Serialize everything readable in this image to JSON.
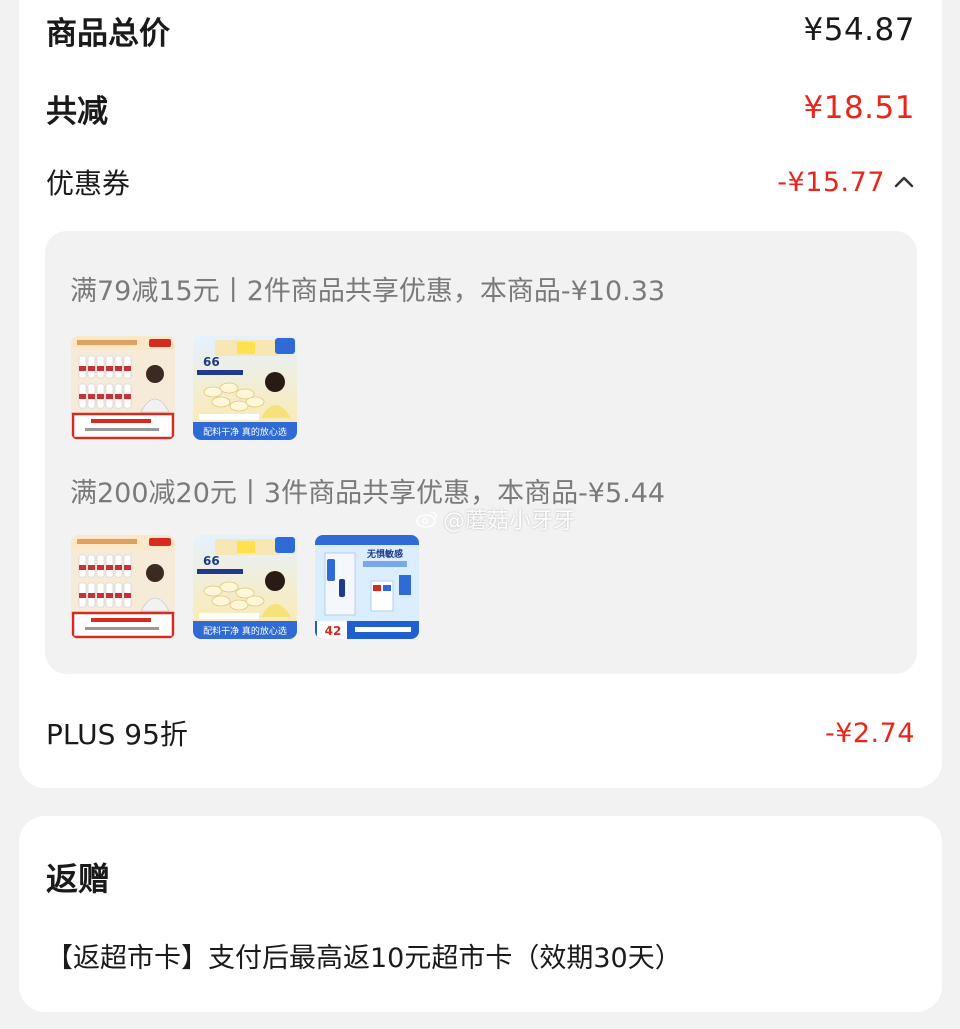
{
  "summary": {
    "total_label": "商品总价",
    "total_value": "¥54.87",
    "reduce_label": "共减",
    "reduce_value": "¥18.51",
    "coupon_label": "优惠券",
    "coupon_value": "-¥15.77",
    "plus_label": "PLUS 95折",
    "plus_value": "-¥2.74"
  },
  "coupon_details": [
    {
      "text": "满79减15元丨2件商品共享优惠，本商品-¥10.33",
      "thumbnails": [
        "milk-bottles-thumbnail",
        "milk-tablets-thumbnail"
      ]
    },
    {
      "text": "满200减20元丨3件商品共享优惠，本商品-¥5.44",
      "thumbnails": [
        "milk-bottles-thumbnail",
        "milk-tablets-thumbnail",
        "health-product-thumbnail"
      ]
    }
  ],
  "thumb_texts": {
    "milk_big": "66",
    "milk_bottom": "配料干净 真的放心选",
    "health_price": "42",
    "health_top": "无惧敏感"
  },
  "gift": {
    "title": "返赠",
    "text": "【返超市卡】支付后最高返10元超市卡（效期30天）"
  },
  "watermark": {
    "text": "@蘑菇小牙牙"
  },
  "colors": {
    "accent_red": "#e8261c",
    "muted_gray": "#7a7a7a",
    "card_bg": "#ffffff",
    "page_bg": "#f2f2f2"
  }
}
